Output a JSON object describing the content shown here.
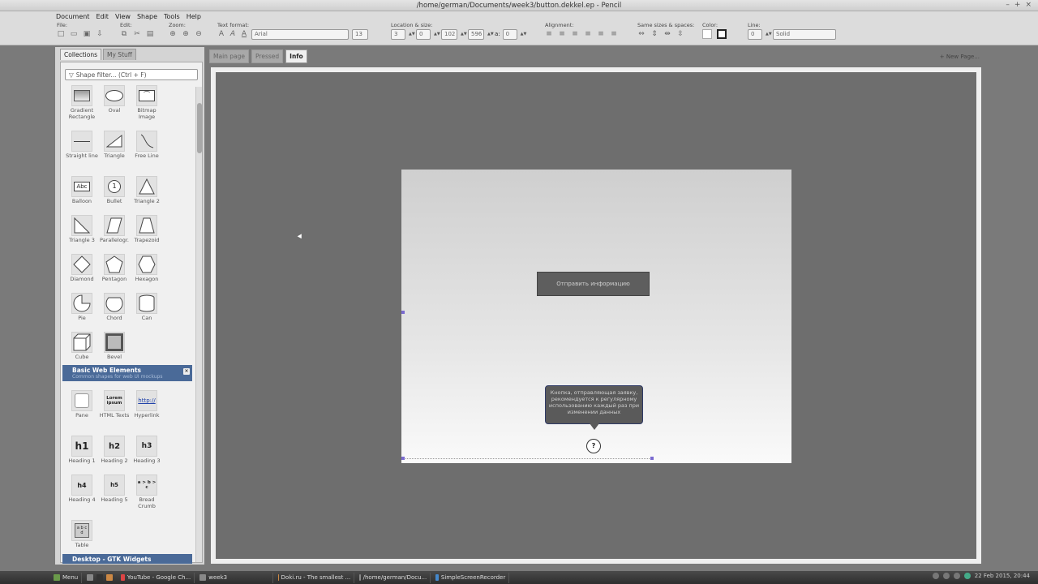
{
  "window": {
    "title": "/home/german/Documents/week3/button.dekkel.ep - Pencil",
    "controls": [
      "–",
      "+",
      "×"
    ]
  },
  "menu": [
    "Document",
    "Edit",
    "View",
    "Shape",
    "Tools",
    "Help"
  ],
  "toolbar": {
    "file_label": "File:",
    "edit_label": "Edit:",
    "zoom_label": "Zoom:",
    "text_format_label": "Text format:",
    "font_name": "Arial",
    "font_size": "13",
    "location_label": "Location & size:",
    "x": "3",
    "y": "0",
    "w": "102",
    "h": "596",
    "angle_label": "a:",
    "angle": "0",
    "alignment_label": "Alignment:",
    "same_sizes_label": "Same sizes & spaces:",
    "color_label": "Color:",
    "line_label": "Line:",
    "line_width": "0",
    "line_style": "Solid"
  },
  "left_panel": {
    "tabs": [
      "Collections",
      "My Stuff"
    ],
    "filter_placeholder": "Shape filter... (Ctrl + F)",
    "shapes": [
      {
        "label": "Gradient Rectangle",
        "icon": "gradient-rect-icon"
      },
      {
        "label": "Oval",
        "icon": "oval-icon"
      },
      {
        "label": "Bitmap Image",
        "icon": "bitmap-image-icon"
      },
      {
        "label": "Straight line",
        "icon": "line-icon"
      },
      {
        "label": "Triangle",
        "icon": "triangle-icon"
      },
      {
        "label": "Free Line",
        "icon": "free-line-icon"
      },
      {
        "label": "Balloon",
        "icon": "balloon-icon"
      },
      {
        "label": "Bullet",
        "icon": "bullet-icon"
      },
      {
        "label": "Triangle 2",
        "icon": "triangle2-icon"
      },
      {
        "label": "Triangle 3",
        "icon": "triangle3-icon"
      },
      {
        "label": "Parallelogr.",
        "icon": "parallelogram-icon"
      },
      {
        "label": "Trapezoid",
        "icon": "trapezoid-icon"
      },
      {
        "label": "Diamond",
        "icon": "diamond-icon"
      },
      {
        "label": "Pentagon",
        "icon": "pentagon-icon"
      },
      {
        "label": "Hexagon",
        "icon": "hexagon-icon"
      },
      {
        "label": "Pie",
        "icon": "pie-icon"
      },
      {
        "label": "Chord",
        "icon": "chord-icon"
      },
      {
        "label": "Can",
        "icon": "can-icon"
      },
      {
        "label": "Cube",
        "icon": "cube-icon"
      },
      {
        "label": "Bevel",
        "icon": "bevel-icon"
      }
    ],
    "section1": {
      "title": "Basic Web Elements",
      "subtitle": "Common shapes for web UI mockups",
      "close": "×"
    },
    "web_shapes": [
      {
        "label": "Pane",
        "glyph": ""
      },
      {
        "label": "HTML Texts",
        "glyph": "Lorem ipsum"
      },
      {
        "label": "Hyperlink",
        "glyph": "http://"
      },
      {
        "label": "Heading 1",
        "glyph": "h1"
      },
      {
        "label": "Heading 2",
        "glyph": "h2"
      },
      {
        "label": "Heading 3",
        "glyph": "h3"
      },
      {
        "label": "Heading 4",
        "glyph": "h4"
      },
      {
        "label": "Heading 5",
        "glyph": "h5"
      },
      {
        "label": "Bread Crumb",
        "glyph": "a > b > c"
      },
      {
        "label": "Table",
        "glyph": "a b c d"
      }
    ],
    "section2": {
      "title": "Desktop - GTK Widgets"
    }
  },
  "page_tabs": [
    "Main page",
    "Pressed",
    "Info"
  ],
  "new_page_label": "New Page...",
  "canvas": {
    "button_text": "Отправить информацию",
    "tooltip_text": "Кнопка, отправляющая заявку, рекомендуется к регулярному использованию каждый раз при изменении данных",
    "help_glyph": "?"
  },
  "taskbar": {
    "menu_label": "Menu",
    "items": [
      "YouTube - Google Ch...",
      "week3",
      "Doki.ru - The smallest ...",
      "/home/german/Docu...",
      "SimpleScreenRecorder"
    ],
    "clock": "22 Feb 2015, 20:44"
  }
}
